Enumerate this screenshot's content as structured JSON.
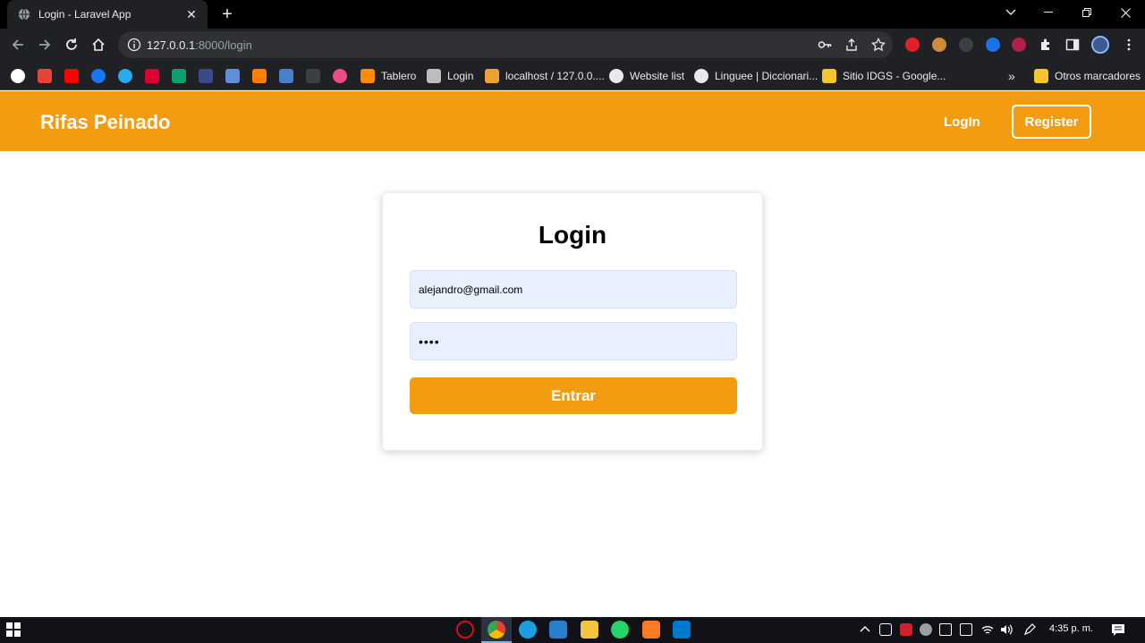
{
  "browser": {
    "tab_title": "Login - Laravel App",
    "new_tab_symbol": "+",
    "close_symbol": "✕",
    "url_host": "127.0.0.1",
    "url_path": ":8000/login",
    "bookmarks": [
      {
        "label": "Tablero",
        "icon": "tablero-icon",
        "color": "#ff8a00"
      },
      {
        "label": "Login",
        "icon": "page-icon",
        "color": "#bdbdbd"
      },
      {
        "label": "localhost / 127.0.0....",
        "icon": "phpmyadmin-icon",
        "color": "#f0a030"
      },
      {
        "label": "Website list",
        "icon": "globe-icon",
        "color": "#e8eaed"
      },
      {
        "label": "Linguee | Diccionari...",
        "icon": "globe-icon",
        "color": "#e8eaed"
      },
      {
        "label": "Sitio IDGS - Google...",
        "icon": "google-sites-icon",
        "color": "#f7c52b"
      }
    ],
    "more_bookmarks": "»",
    "other_bookmarks": "Otros marcadores"
  },
  "app": {
    "brand": "Rifas Peinado",
    "nav_login": "LogIn",
    "nav_register": "Register",
    "accent": "#f39c12"
  },
  "login": {
    "heading": "Login",
    "email_value": "alejandro@gmail.com",
    "password_value": "••••",
    "submit_label": "Entrar"
  },
  "taskbar": {
    "clock": "4:35 p. m."
  }
}
